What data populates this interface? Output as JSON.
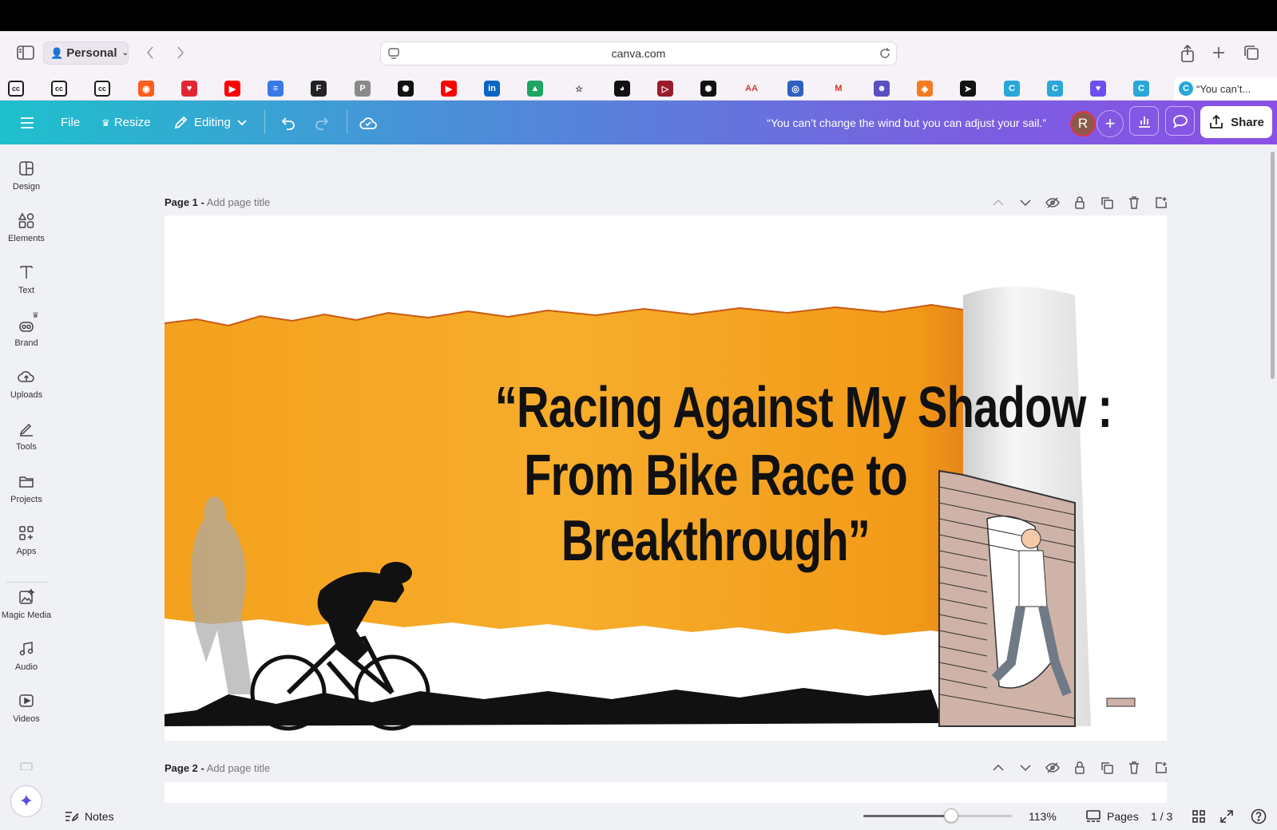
{
  "browser": {
    "profile_label": "Personal",
    "url": "canva.com",
    "active_tab_title": "“You can’t..."
  },
  "bookmarks": [
    {
      "icon": "cc-icon",
      "color": "#1d1d1d",
      "glyph": "cc"
    },
    {
      "icon": "cc-icon",
      "color": "#1d1d1d",
      "glyph": "cc"
    },
    {
      "icon": "cc-icon",
      "color": "#1d1d1d",
      "glyph": "cc"
    },
    {
      "icon": "semrush-icon",
      "color": "#ff5c1f",
      "glyph": "◉"
    },
    {
      "icon": "heart-icon",
      "color": "#e32636",
      "glyph": "♥"
    },
    {
      "icon": "youtube-icon",
      "color": "#ff0000",
      "glyph": "▶"
    },
    {
      "icon": "docs-icon",
      "color": "#3b78e7",
      "glyph": "≡"
    },
    {
      "icon": "f-icon",
      "color": "#222222",
      "glyph": "F"
    },
    {
      "icon": "p-icon",
      "color": "#8a8a8a",
      "glyph": "P"
    },
    {
      "icon": "chatgpt-icon",
      "color": "#111111",
      "glyph": "✺"
    },
    {
      "icon": "youtube-icon",
      "color": "#ff0000",
      "glyph": "▶"
    },
    {
      "icon": "linkedin-icon",
      "color": "#0a66c2",
      "glyph": "in"
    },
    {
      "icon": "drive-icon",
      "color": "#1fa463",
      "glyph": "▲"
    },
    {
      "icon": "star-icon",
      "color": "#f6f2f8",
      "glyph": "☆"
    },
    {
      "icon": "github-icon",
      "color": "#111111",
      "glyph": "◕"
    },
    {
      "icon": "play-icon",
      "color": "#9a1c2a",
      "glyph": "▷"
    },
    {
      "icon": "openai-icon",
      "color": "#111111",
      "glyph": "✺"
    },
    {
      "icon": "aa-icon",
      "color": "#f6f2f8",
      "glyph": "AA"
    },
    {
      "icon": "circle-icon",
      "color": "#2f5fbf",
      "glyph": "◎"
    },
    {
      "icon": "gmail-icon",
      "color": "#f6f2f8",
      "glyph": "M"
    },
    {
      "icon": "bot-icon",
      "color": "#5a4fbf",
      "glyph": "☻"
    },
    {
      "icon": "stack-icon",
      "color": "#f47b20",
      "glyph": "◈"
    },
    {
      "icon": "telegram-icon",
      "color": "#111111",
      "glyph": "➤"
    },
    {
      "icon": "canva-icon",
      "color": "#2aa6d8",
      "glyph": "C"
    },
    {
      "icon": "canva-icon",
      "color": "#2aa6d8",
      "glyph": "C"
    },
    {
      "icon": "heart-chat-icon",
      "color": "#6b4ff0",
      "glyph": "♥"
    },
    {
      "icon": "canva-icon",
      "color": "#2aa6d8",
      "glyph": "C"
    },
    {
      "icon": "video-icon",
      "color": "#6b4ff0",
      "glyph": "▶"
    }
  ],
  "toolbar": {
    "file_label": "File",
    "resize_label": "Resize",
    "editing_label": "Editing",
    "design_title": "“You can’t change the wind but you can adjust your sail.”",
    "avatar_initial": "R",
    "share_label": "Share"
  },
  "sidebar": {
    "items": [
      {
        "label": "Design",
        "icon": "design-icon"
      },
      {
        "label": "Elements",
        "icon": "elements-icon"
      },
      {
        "label": "Text",
        "icon": "text-icon"
      },
      {
        "label": "Brand",
        "icon": "brand-icon"
      },
      {
        "label": "Uploads",
        "icon": "uploads-icon"
      },
      {
        "label": "Tools",
        "icon": "tools-icon"
      },
      {
        "label": "Projects",
        "icon": "projects-icon"
      },
      {
        "label": "Apps",
        "icon": "apps-icon"
      },
      {
        "label": "Magic Media",
        "icon": "magic-media-icon"
      },
      {
        "label": "Audio",
        "icon": "audio-icon"
      },
      {
        "label": "Videos",
        "icon": "videos-icon"
      }
    ]
  },
  "pages": [
    {
      "label": "Page 1 -",
      "title_placeholder": "Add page title"
    },
    {
      "label": "Page 2 -",
      "title_placeholder": "Add page title"
    }
  ],
  "slide": {
    "headline_line1": "“Racing Against My Shadow :",
    "headline_line2": "From Bike Race to Breakthrough”",
    "background_color": "#f5a623"
  },
  "footer": {
    "notes_label": "Notes",
    "zoom_value": "113%",
    "zoom_fraction": 0.59,
    "pages_label": "Pages",
    "page_counter": "1 / 3"
  }
}
